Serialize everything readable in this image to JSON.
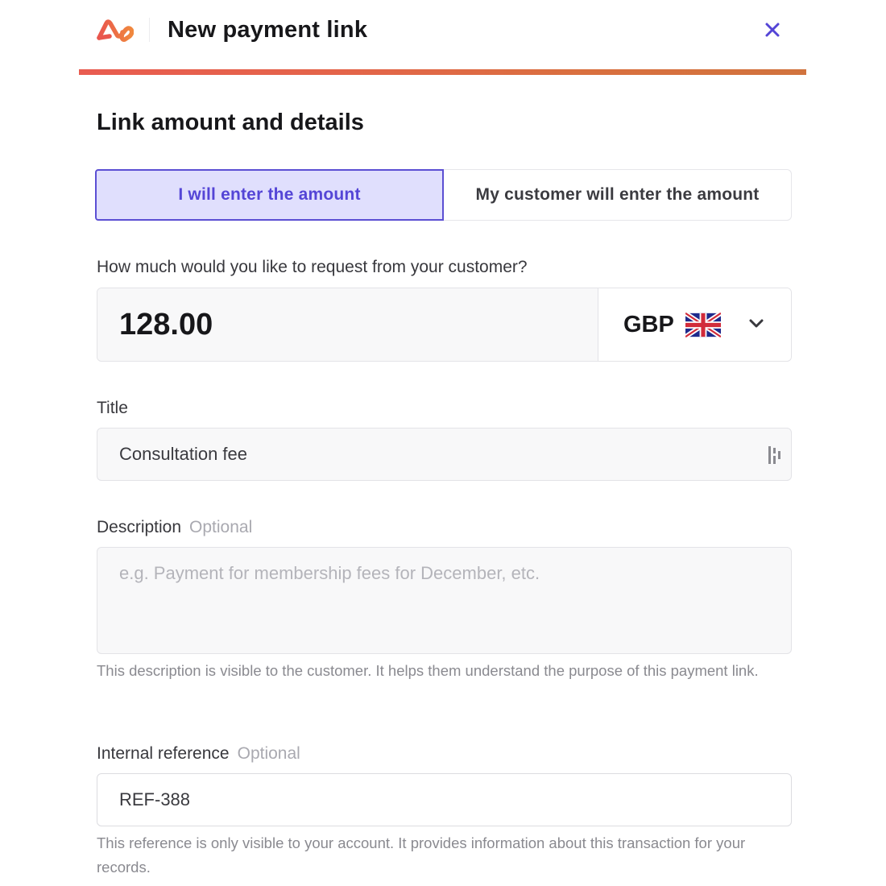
{
  "header": {
    "title": "New payment link",
    "logo_icon": "brand-logo-icon",
    "close_icon": "close-icon",
    "accent_color": "#5445d6",
    "progress": 1.0,
    "progress_gradient": [
      "#e95c50",
      "#d1733e"
    ]
  },
  "section": {
    "title": "Link amount and details"
  },
  "amount_mode": {
    "options": [
      {
        "label": "I will enter the amount",
        "selected": true
      },
      {
        "label": "My customer will enter the amount",
        "selected": false
      }
    ]
  },
  "amount": {
    "label": "How much would you like to request from your customer?",
    "value": "128.00",
    "currency": "GBP",
    "currency_flag": "uk-flag-icon",
    "dropdown_icon": "chevron-down-icon"
  },
  "title_field": {
    "label": "Title",
    "value": "Consultation fee",
    "extension_icon": "password-manager-icon"
  },
  "description": {
    "label": "Description",
    "optional": "Optional",
    "placeholder": "e.g. Payment for membership fees for December, etc.",
    "value": "",
    "help": "This description is visible to the customer. It helps them understand the purpose of this payment link."
  },
  "internal_reference": {
    "label": "Internal reference",
    "optional": "Optional",
    "value": "REF-388",
    "help": "This reference is only visible to your account. It provides information about this transaction for your records."
  }
}
